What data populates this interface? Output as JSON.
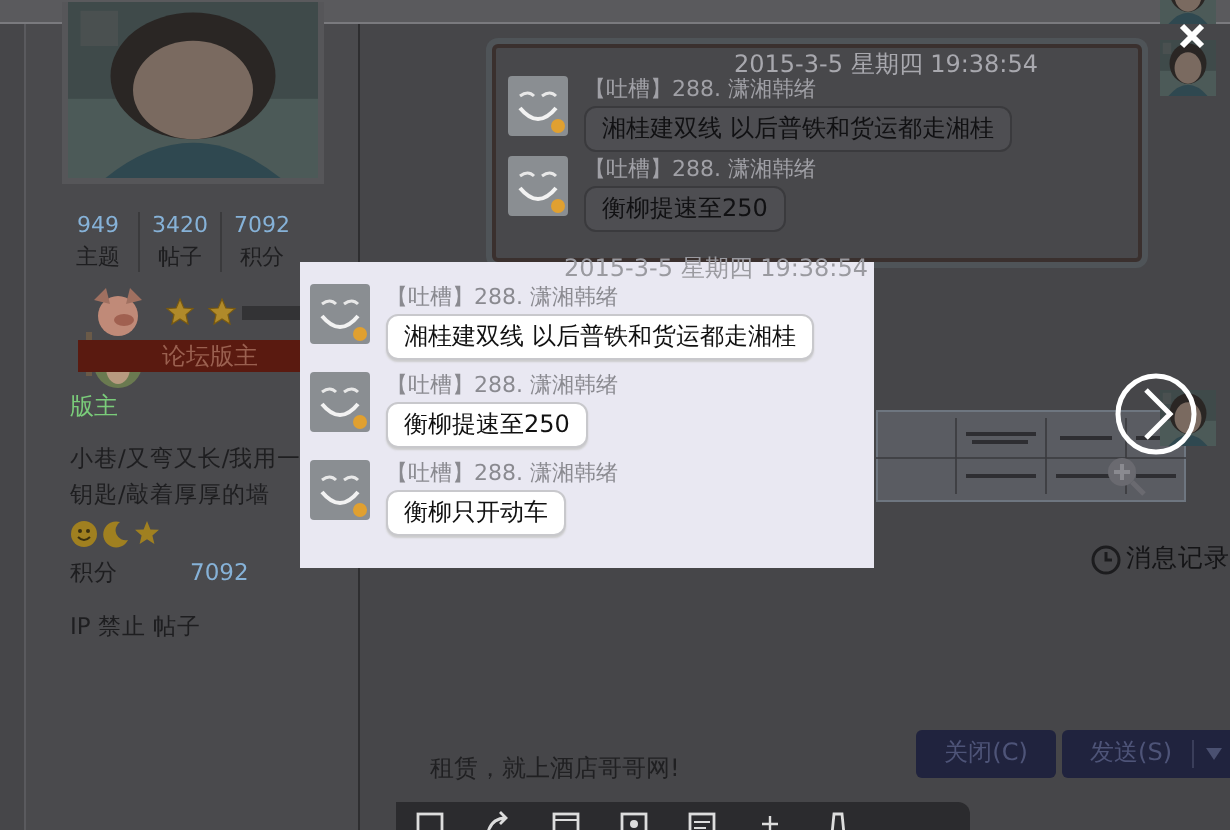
{
  "post": {
    "stats": [
      {
        "value": "949",
        "label": "主题"
      },
      {
        "value": "3420",
        "label": "帖子"
      },
      {
        "value": "7092",
        "label": "积分"
      }
    ],
    "stars": 2,
    "rank_badge": "论坛版主",
    "group": "版主",
    "signature_lines": [
      "小巷/又弯又长/我用一",
      "钥匙/敲着厚厚的墙"
    ],
    "points": {
      "label": "积分",
      "value": "7092"
    },
    "ip_line": "IP 禁止 帖子"
  },
  "chat": {
    "timestamp": "2015-3-5 星期四 19:38:54",
    "messages": [
      {
        "sender": "【吐槽】288. 潇湘韩绪",
        "text": "湘桂建双线 以后普铁和货运都走湘桂"
      },
      {
        "sender": "【吐槽】288. 潇湘韩绪",
        "text": "衡柳提速至250"
      }
    ],
    "history_link": "消息记录",
    "ad_text": "租赁，就上酒店哥哥网!",
    "buttons": [
      {
        "label": "关闭(C)",
        "dropdown": false
      },
      {
        "label": "发送(S)",
        "dropdown": true
      }
    ]
  },
  "lightbox": {
    "timestamp": "2015-3-5 星期四 19:38:54",
    "messages": [
      {
        "sender": "【吐槽】288. 潇湘韩绪",
        "text": "湘桂建双线 以后普铁和货运都走湘桂"
      },
      {
        "sender": "【吐槽】288. 潇湘韩绪",
        "text": "衡柳提速至250"
      },
      {
        "sender": "【吐槽】288. 潇湘韩绪",
        "text": "衡柳只开动车"
      }
    ]
  }
}
